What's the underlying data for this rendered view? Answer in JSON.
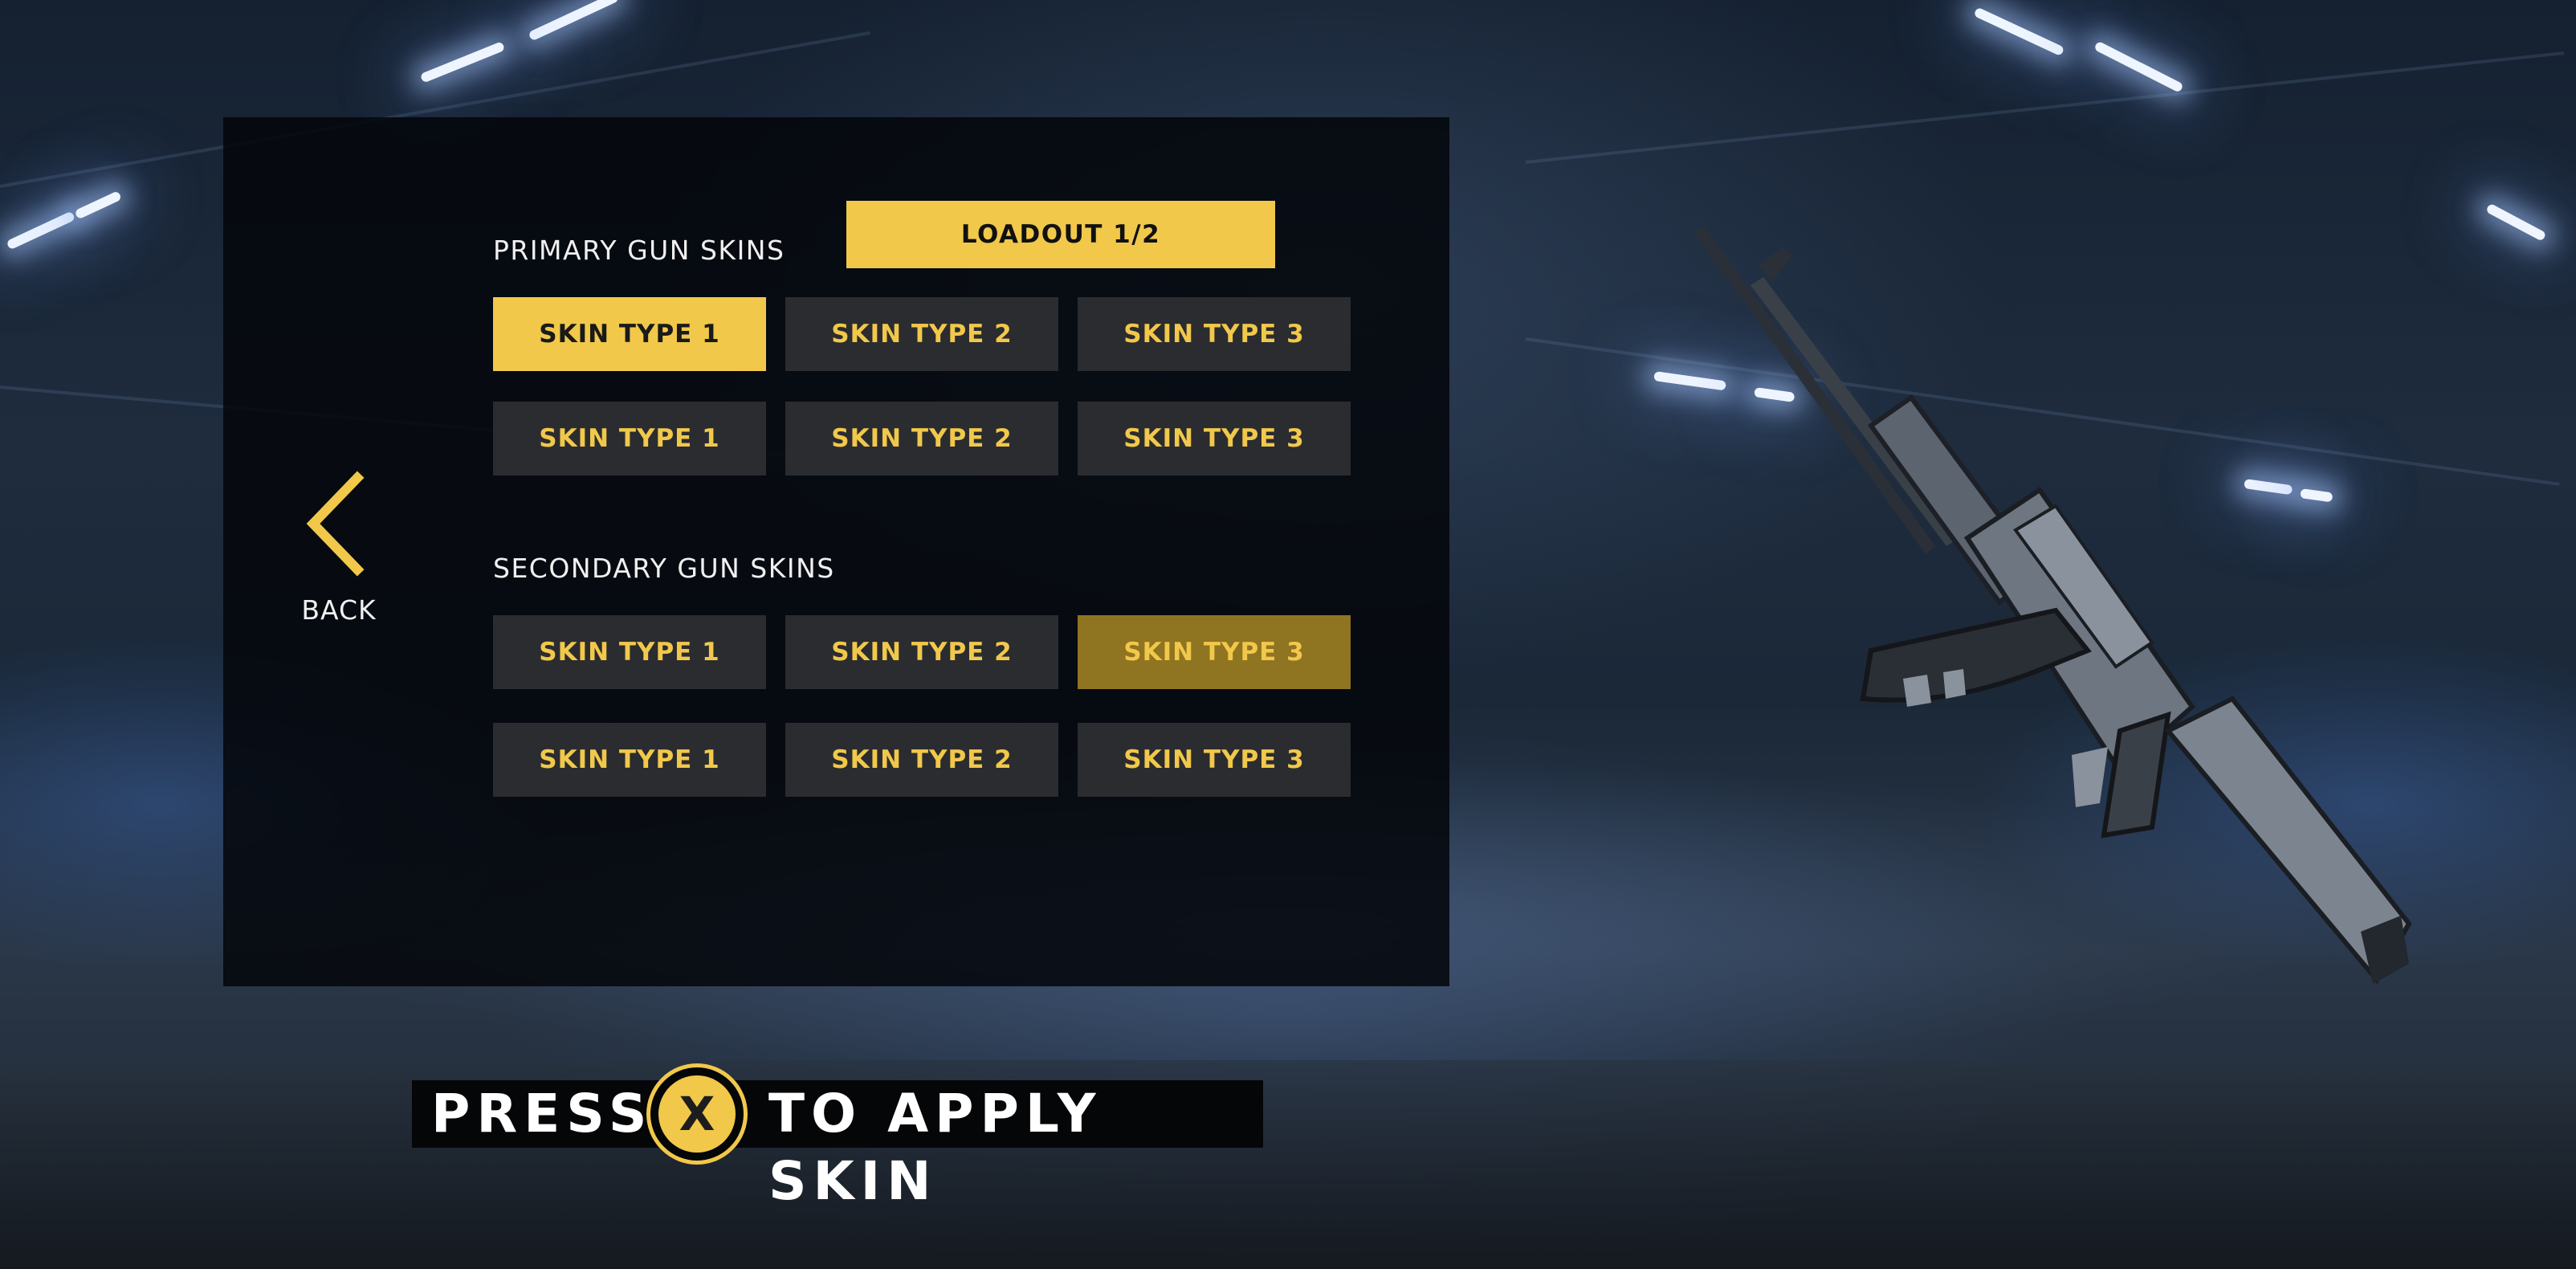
{
  "loadout_tab": {
    "label": "LOADOUT 1/2"
  },
  "back": {
    "label": "BACK",
    "icon": "chevron-left-icon"
  },
  "primary": {
    "title": "PRIMARY GUN SKINS",
    "rows": [
      [
        {
          "label": "SKIN TYPE 1",
          "state": "selected"
        },
        {
          "label": "SKIN TYPE 2",
          "state": "normal"
        },
        {
          "label": "SKIN TYPE 3",
          "state": "normal"
        }
      ],
      [
        {
          "label": "SKIN TYPE 1",
          "state": "normal"
        },
        {
          "label": "SKIN TYPE 2",
          "state": "normal"
        },
        {
          "label": "SKIN TYPE 3",
          "state": "normal"
        }
      ]
    ]
  },
  "secondary": {
    "title": "SECONDARY GUN SKINS",
    "rows": [
      [
        {
          "label": "SKIN TYPE 1",
          "state": "normal"
        },
        {
          "label": "SKIN TYPE 2",
          "state": "normal"
        },
        {
          "label": "SKIN TYPE 3",
          "state": "highlighted"
        }
      ],
      [
        {
          "label": "SKIN TYPE 1",
          "state": "normal"
        },
        {
          "label": "SKIN TYPE 2",
          "state": "normal"
        },
        {
          "label": "SKIN TYPE 3",
          "state": "normal"
        }
      ]
    ]
  },
  "prompt": {
    "before": "PRESS",
    "button": "X",
    "after": "TO APPLY SKIN"
  },
  "colors": {
    "accent": "#f1c84a",
    "button_bg": "#2b2c30",
    "panel_bg": "#04060a"
  }
}
